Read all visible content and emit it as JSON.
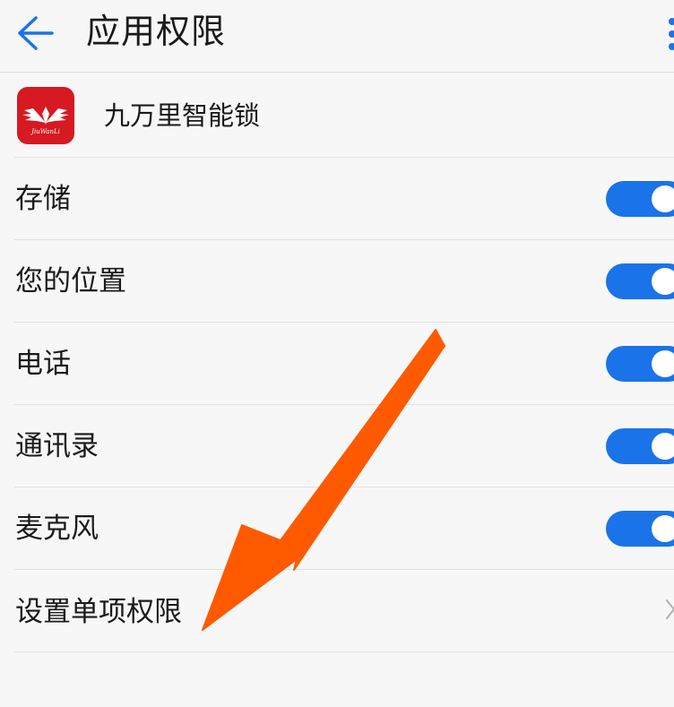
{
  "header": {
    "title": "应用权限",
    "back_icon": "arrow-left-icon",
    "more_icon": "more-vertical-icon"
  },
  "app": {
    "name": "九万里智能锁",
    "logo_text": "JiuWanLi",
    "icon_color": "#d71921"
  },
  "permissions": [
    {
      "label": "存储",
      "enabled": true
    },
    {
      "label": "您的位置",
      "enabled": true
    },
    {
      "label": "电话",
      "enabled": true
    },
    {
      "label": "通讯录",
      "enabled": true
    },
    {
      "label": "麦克风",
      "enabled": true
    }
  ],
  "individual_setting": {
    "label": "设置单项权限",
    "icon": "chevron-right-icon"
  },
  "colors": {
    "accent": "#1a73e8",
    "annotation_arrow": "#ff5a00",
    "background": "#f7f7f7"
  }
}
